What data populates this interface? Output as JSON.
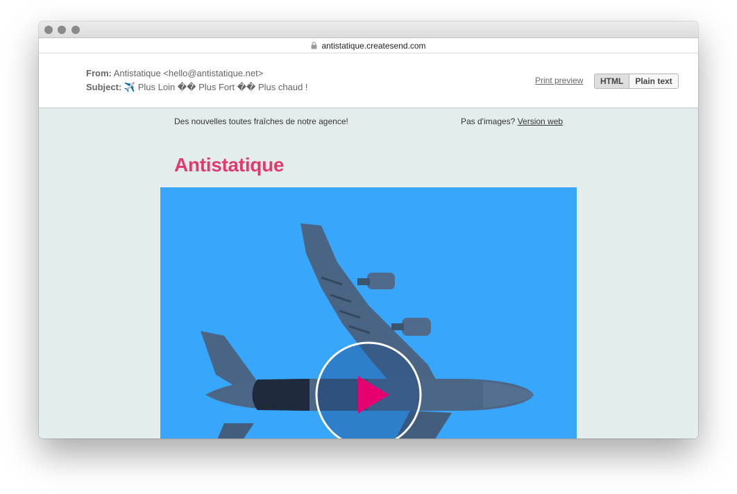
{
  "browser": {
    "url": "antistatique.createsend.com"
  },
  "email_header": {
    "from_label": "From:",
    "from_value": "Antistatique <hello@antistatique.net>",
    "subject_label": "Subject:",
    "subject_value": "✈️ Plus Loin �� Plus Fort �� Plus chaud !",
    "print_preview": "Print preview",
    "view_modes": [
      "HTML",
      "Plain text"
    ],
    "active_view_mode": "HTML"
  },
  "newsletter": {
    "preheader": "Des nouvelles toutes fraîches de notre agence!",
    "no_images_text": "Pas d'images?",
    "web_version_link": "Version web",
    "brand_name": "Antistatique",
    "hero": {
      "subject": "airplane-from-below",
      "overlay_icon": "play-icon"
    }
  },
  "colors": {
    "brand": "#e13a6d",
    "hero_background": "#37a6fb",
    "play_triangle": "#e6006f",
    "body_background": "#e4eded"
  }
}
